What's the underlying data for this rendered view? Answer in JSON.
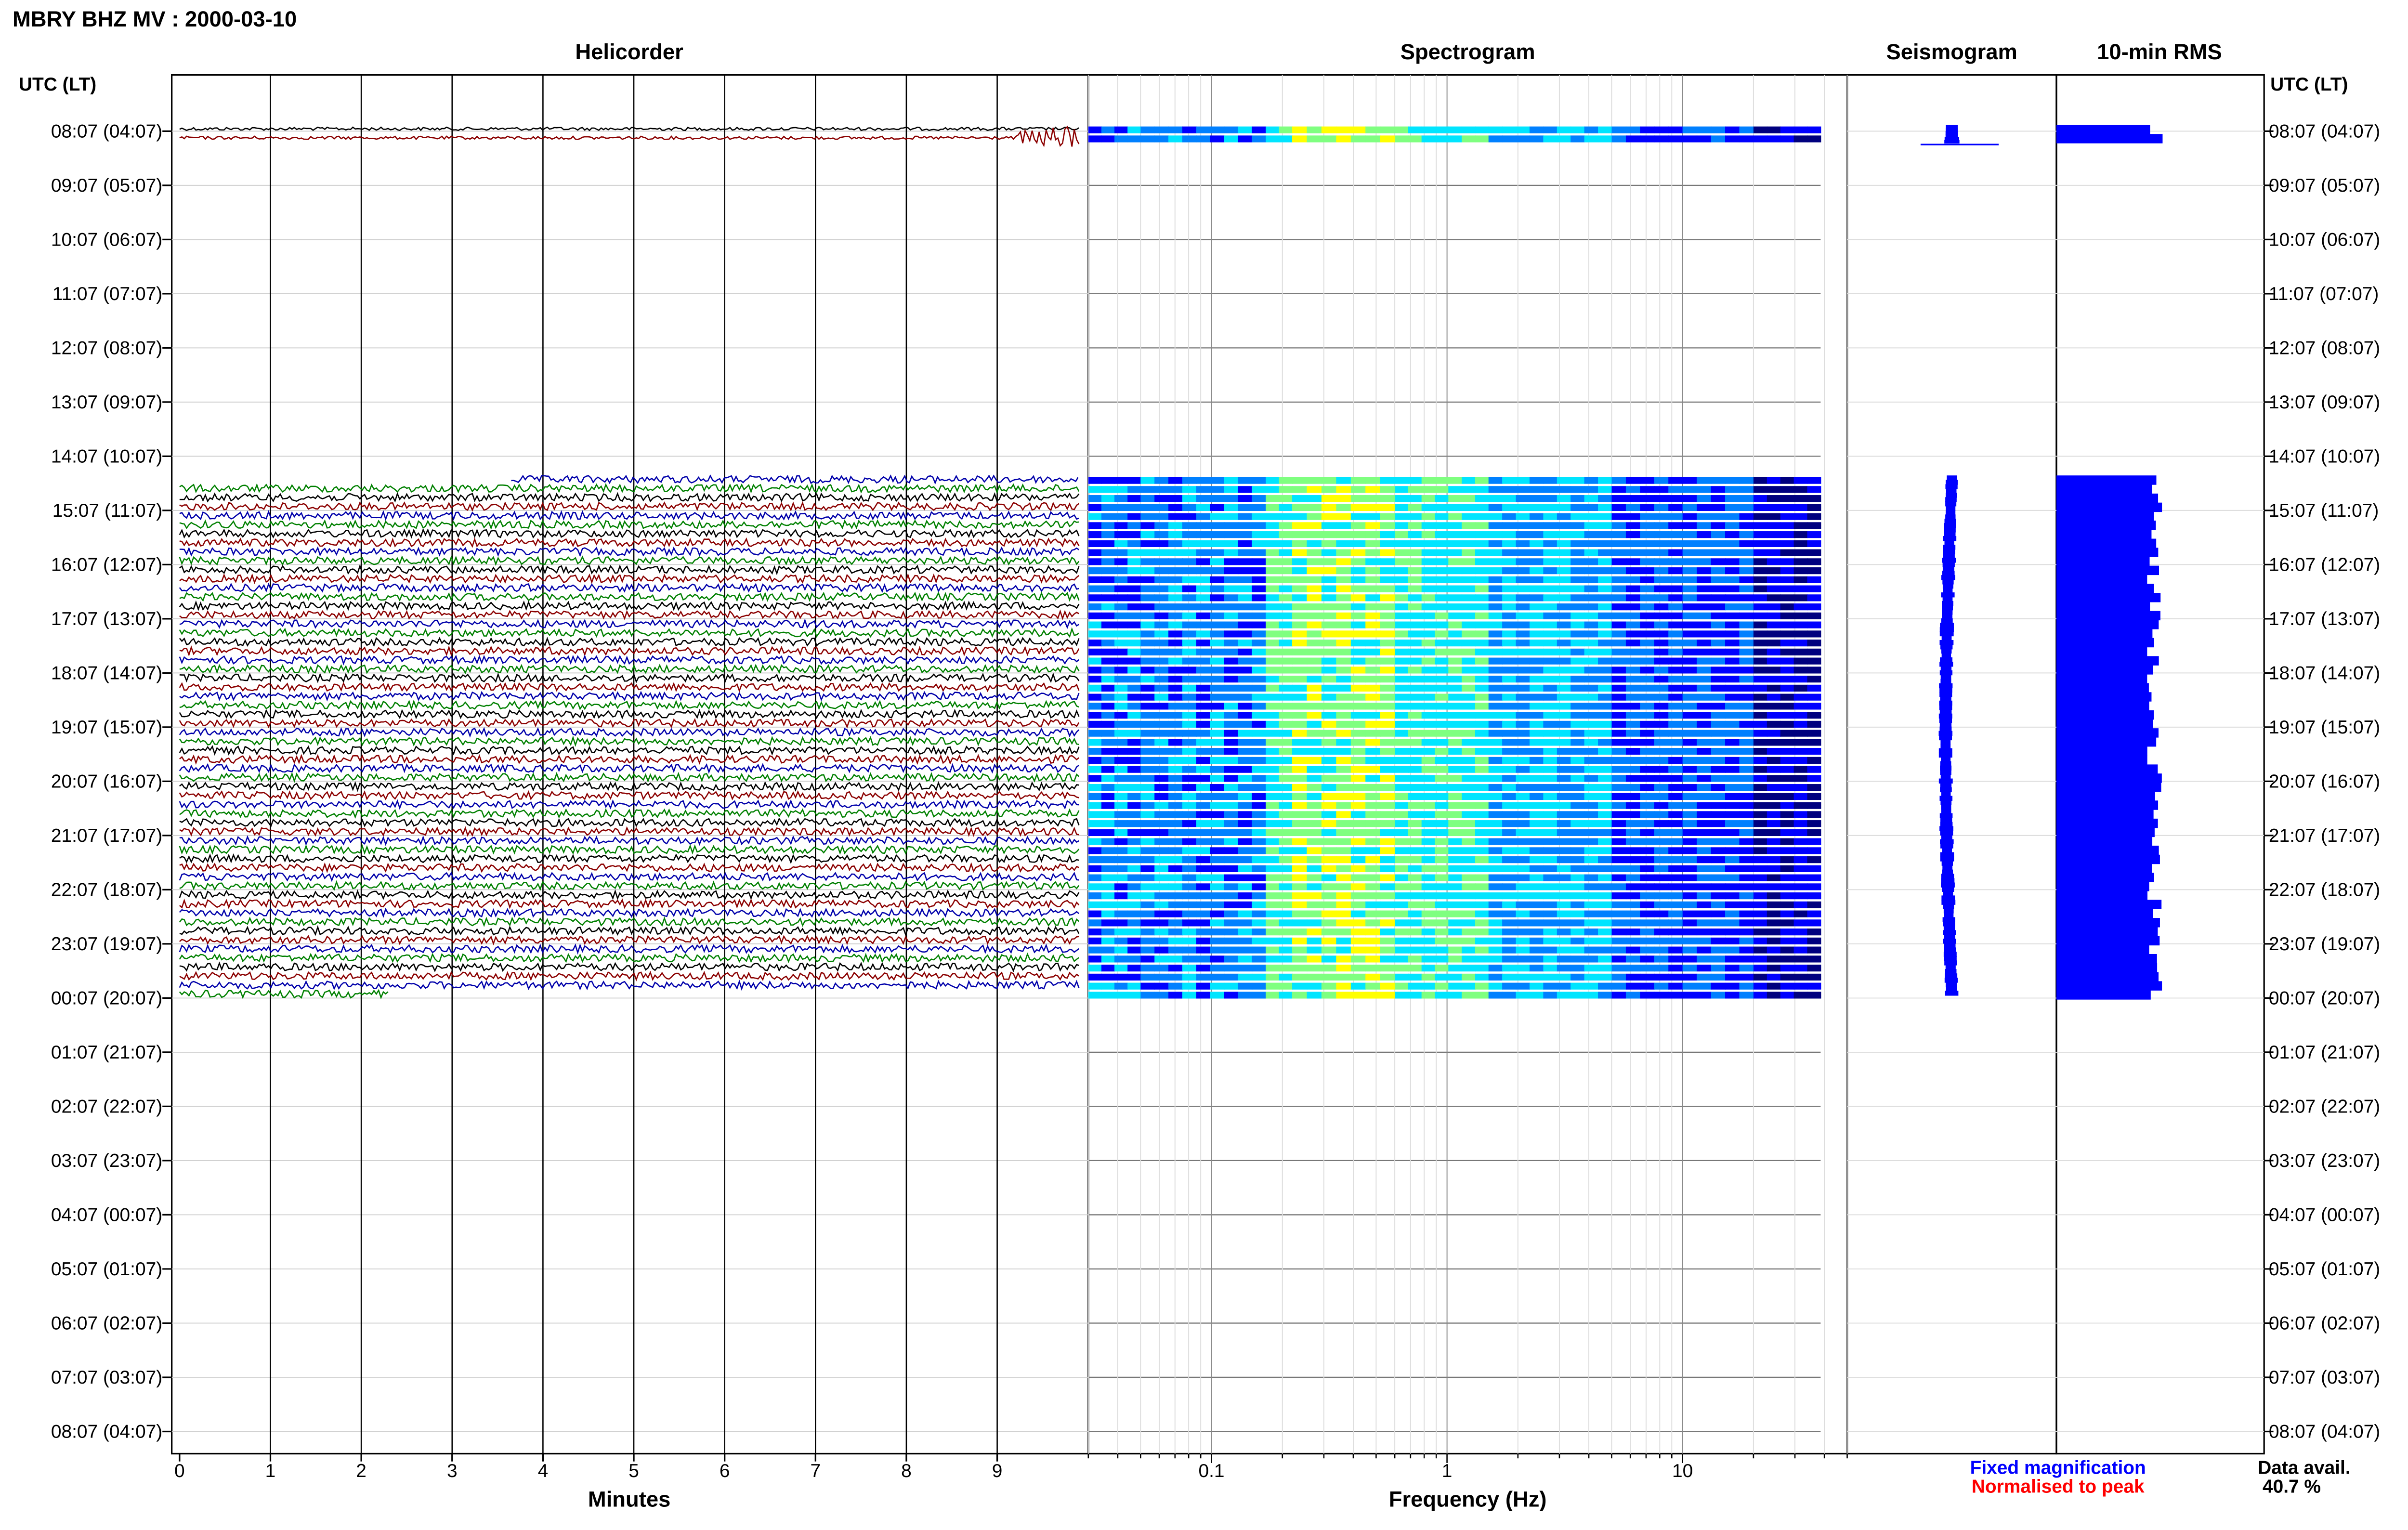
{
  "page_title": "MBRY BHZ MV : 2000-03-10",
  "panels": {
    "helicorder": "Helicorder",
    "spectrogram": "Spectrogram",
    "seismogram": "Seismogram",
    "rms": "10-min RMS"
  },
  "axis_headers": {
    "left": "UTC (LT)",
    "right": "UTC (LT)"
  },
  "x_labels": {
    "helicorder": "Minutes",
    "spectrogram": "Frequency (Hz)"
  },
  "legend": {
    "fixed": "Fixed magnification",
    "fixed_color": "#0000ff",
    "normalised": "Normalised to peak",
    "normalised_color": "#ff0000"
  },
  "data_avail": {
    "label": "Data avail.",
    "value": "40.7 %"
  },
  "trace_colors": [
    "#000000",
    "#8b0000",
    "#0000aa",
    "#008000"
  ],
  "chart_data": [
    {
      "type": "line",
      "title": "Helicorder",
      "xlabel": "Minutes",
      "x_ticks": [
        "0",
        "1",
        "2",
        "3",
        "4",
        "5",
        "6",
        "7",
        "8",
        "9"
      ],
      "xlim": [
        0,
        10
      ],
      "y_ticks": [
        "08:07 (04:07)",
        "09:07 (05:07)",
        "10:07 (06:07)",
        "11:07 (07:07)",
        "12:07 (08:07)",
        "13:07 (09:07)",
        "14:07 (10:07)",
        "15:07 (11:07)",
        "16:07 (12:07)",
        "17:07 (13:07)",
        "18:07 (14:07)",
        "19:07 (15:07)",
        "20:07 (16:07)",
        "21:07 (17:07)",
        "22:07 (18:07)",
        "23:07 (19:07)",
        "00:07 (20:07)",
        "01:07 (21:07)",
        "02:07 (22:07)",
        "03:07 (23:07)",
        "04:07 (00:07)",
        "05:07 (01:07)",
        "06:07 (02:07)",
        "07:07 (03:07)",
        "08:07 (04:07)"
      ],
      "segments": [
        {
          "start_hour": 0,
          "end_hour": 0.333
        },
        {
          "start_hour": 6.47,
          "end_hour": 16.06
        }
      ]
    },
    {
      "type": "heatmap",
      "title": "Spectrogram",
      "xlabel": "Frequency (Hz)",
      "x_scale": "log",
      "x_ticks": [
        "0.1",
        "1",
        "10"
      ],
      "xlim": [
        0.03,
        50
      ],
      "colormap": [
        "#00007f",
        "#0000ff",
        "#0080ff",
        "#00e5ff",
        "#7fff80",
        "#ffff00"
      ],
      "segments": [
        {
          "start_hour": 0,
          "end_hour": 0.333
        },
        {
          "start_hour": 6.47,
          "end_hour": 16.06
        }
      ]
    },
    {
      "type": "line",
      "title": "Seismogram",
      "segments": [
        {
          "start_hour": 0,
          "end_hour": 0.333
        },
        {
          "start_hour": 6.47,
          "end_hour": 16.06
        }
      ]
    },
    {
      "type": "bar",
      "title": "10-min RMS",
      "segments": [
        {
          "start_hour": 0,
          "end_hour": 0.333
        },
        {
          "start_hour": 6.47,
          "end_hour": 16.06
        }
      ]
    }
  ]
}
